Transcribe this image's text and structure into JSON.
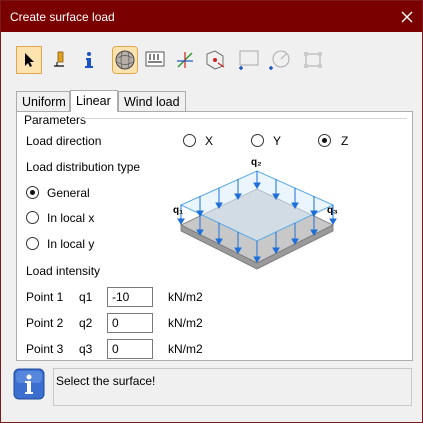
{
  "window": {
    "title": "Create surface load"
  },
  "tabs": [
    {
      "label": "Uniform",
      "selected": false
    },
    {
      "label": "Linear",
      "selected": true
    },
    {
      "label": "Wind load",
      "selected": false
    }
  ],
  "parameters": {
    "group_label": "Parameters",
    "load_direction": {
      "label": "Load direction",
      "options": [
        {
          "label": "X",
          "selected": false
        },
        {
          "label": "Y",
          "selected": false
        },
        {
          "label": "Z",
          "selected": true
        }
      ]
    },
    "distribution": {
      "label": "Load distribution type",
      "options": [
        {
          "label": "General",
          "selected": true
        },
        {
          "label": "In local x",
          "selected": false
        },
        {
          "label": "In local y",
          "selected": false
        }
      ]
    },
    "diagram_labels": {
      "q1": "q₁",
      "q2": "q₂",
      "q3": "q₃"
    },
    "intensity": {
      "label": "Load intensity",
      "rows": [
        {
          "point": "Point 1",
          "q": "q1",
          "value": "-10",
          "unit": "kN/m2"
        },
        {
          "point": "Point 2",
          "q": "q2",
          "value": "0",
          "unit": "kN/m2"
        },
        {
          "point": "Point 3",
          "q": "q3",
          "value": "0",
          "unit": "kN/m2"
        }
      ]
    }
  },
  "status": {
    "message": "Select the surface!"
  },
  "toolbar": {
    "icons": [
      "pointer-icon",
      "paint-icon",
      "info-icon",
      "sphere-icon",
      "load-table-icon",
      "axis-icon",
      "node-move-icon",
      "rect-select-icon",
      "circle-select-icon",
      "mesh-icon"
    ]
  },
  "colors": {
    "title_bar": "#7a0000",
    "accent": "#e3a650",
    "load_blue": "#1e6fd9"
  }
}
